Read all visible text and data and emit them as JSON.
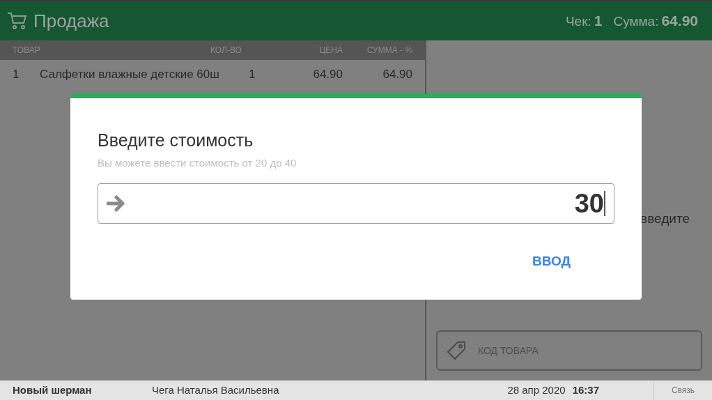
{
  "header": {
    "title": "Продажа",
    "receipt_label": "Чек:",
    "receipt_number": "1",
    "total_label": "Сумма:",
    "total_value": "64.90"
  },
  "table": {
    "columns": [
      "ТОВАР",
      "КОЛ-ВО",
      "ЦЕНА",
      "СУММА - %"
    ],
    "rows": [
      {
        "index": "1",
        "name": "Салфетки влажные детские 60ш",
        "qty": "1",
        "price": "64.90",
        "sum": "64.90"
      }
    ]
  },
  "side_panel": {
    "hint_fragment": "введите",
    "code_field": {
      "placeholder": "КОД ТОВАРА"
    }
  },
  "status_bar": {
    "shop": "Новый шерман",
    "cashier": "Чега Наталья Васильевна",
    "date": "28 апр 2020",
    "time": "16:37",
    "connection": "Связь"
  },
  "dialog": {
    "title": "Введите стоимость",
    "subtitle": "Вы можете ввести стоимость от 20 до 40",
    "value": "30",
    "button": "ВВОД"
  }
}
